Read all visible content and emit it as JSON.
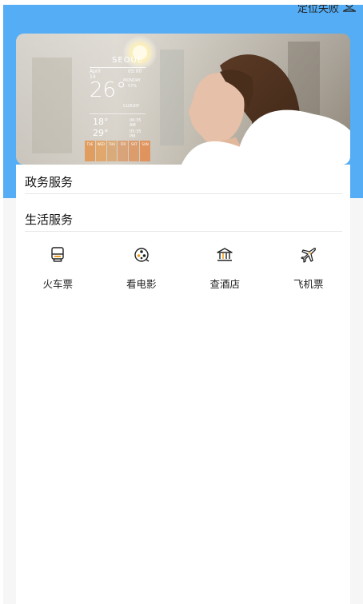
{
  "header": {
    "location_text": "定位失败",
    "location_icon": "location-person-icon",
    "background_color": "#54adf5"
  },
  "banner": {
    "weather": {
      "city": "SEOUL",
      "date": "April 14",
      "time": "05:00",
      "weekday": "MONDAY",
      "humidity": "57%",
      "temperature": "26°",
      "condition": "CLOUDY",
      "low": "18°",
      "high": "29°",
      "sunrise": "06:35 AM",
      "sunset": "05:35 PM",
      "days": [
        "TUE",
        "WED",
        "THU",
        "FRI",
        "SAT",
        "SUN"
      ]
    }
  },
  "sections": {
    "government": {
      "title": "政务服务"
    },
    "life": {
      "title": "生活服务",
      "items": [
        {
          "label": "火车票",
          "icon": "train-icon"
        },
        {
          "label": "看电影",
          "icon": "film-reel-icon"
        },
        {
          "label": "查酒店",
          "icon": "hotel-building-icon"
        },
        {
          "label": "飞机票",
          "icon": "airplane-icon"
        }
      ]
    }
  },
  "colors": {
    "accent": "#54adf5",
    "icon_accent": "#f0a020",
    "card_background": "#ffffff",
    "page_background": "#f6f6f6"
  }
}
